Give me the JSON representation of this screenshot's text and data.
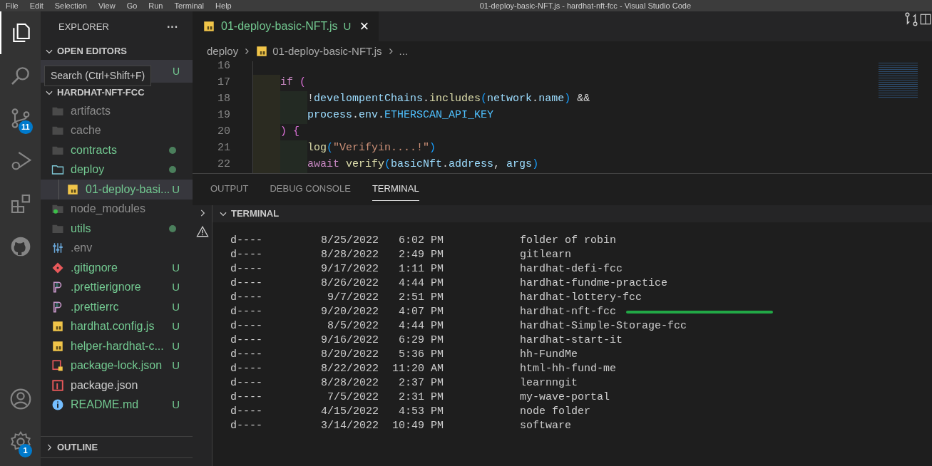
{
  "menu_bar": {
    "items": [
      "File",
      "Edit",
      "Selection",
      "View",
      "Go",
      "Run",
      "Terminal",
      "Help"
    ],
    "title": "01-deploy-basic-NFT.js - hardhat-nft-fcc - Visual Studio Code"
  },
  "activity_bar": [
    {
      "kind": "explorer",
      "selected": true
    },
    {
      "kind": "search",
      "selected": false
    },
    {
      "kind": "source-control",
      "selected": false,
      "badge": "11"
    },
    {
      "kind": "run-debug",
      "selected": false
    },
    {
      "kind": "extensions",
      "selected": false
    },
    {
      "kind": "github",
      "selected": false
    }
  ],
  "activity_bottom": [
    {
      "kind": "account"
    },
    {
      "kind": "settings",
      "badge": "1"
    }
  ],
  "tooltip": "Search (Ctrl+Shift+F)",
  "sidebar": {
    "title": "EXPLORER",
    "more": "···",
    "open_editors": {
      "title": "OPEN EDITORS",
      "expanded": true,
      "items": [
        {
          "decoration": "U"
        }
      ]
    },
    "project": {
      "title": "HARDHAT-NFT-FCC",
      "expanded": true,
      "items": [
        {
          "name": "artifacts",
          "kind": "folder",
          "ignored": true,
          "dot": false,
          "selected": false
        },
        {
          "name": "cache",
          "kind": "folder",
          "ignored": true,
          "dot": false,
          "selected": false
        },
        {
          "name": "contracts",
          "kind": "folder",
          "untracked": true,
          "ignored": false,
          "dot": true,
          "selected": false
        },
        {
          "name": "deploy",
          "kind": "folder-open",
          "untracked": true,
          "ignored": false,
          "dot": true,
          "selected": false,
          "children": [
            {
              "name": "01-deploy-basi...",
              "kind": "js",
              "untracked": true,
              "ignored": false,
              "decoration": "U",
              "selected": true
            }
          ]
        },
        {
          "name": "node_modules",
          "kind": "folder-node",
          "ignored": true,
          "dot": false,
          "selected": false
        },
        {
          "name": "utils",
          "kind": "folder",
          "untracked": true,
          "ignored": false,
          "dot": true,
          "selected": false
        },
        {
          "name": ".env",
          "kind": "env",
          "ignored": true,
          "selected": false
        },
        {
          "name": ".gitignore",
          "kind": "git",
          "untracked": true,
          "ignored": false,
          "decoration": "U",
          "selected": false
        },
        {
          "name": ".prettierignore",
          "kind": "prettier",
          "untracked": true,
          "ignored": false,
          "decoration": "U",
          "selected": false
        },
        {
          "name": ".prettierrc",
          "kind": "prettier",
          "untracked": true,
          "ignored": false,
          "decoration": "U",
          "selected": false
        },
        {
          "name": "hardhat.config.js",
          "kind": "js",
          "untracked": true,
          "ignored": false,
          "decoration": "U",
          "selected": false
        },
        {
          "name": "helper-hardhat-c...",
          "kind": "js",
          "untracked": true,
          "ignored": false,
          "decoration": "U",
          "selected": false
        },
        {
          "name": "package-lock.json",
          "kind": "npm-lock",
          "untracked": true,
          "ignored": false,
          "decoration": "U",
          "selected": false
        },
        {
          "name": "package.json",
          "kind": "npm",
          "untracked": false,
          "ignored": false,
          "selected": false
        },
        {
          "name": "README.md",
          "kind": "info",
          "untracked": true,
          "ignored": false,
          "decoration": "U",
          "selected": false
        }
      ]
    },
    "outline": {
      "title": "OUTLINE",
      "expanded": false
    }
  },
  "editor": {
    "tabs": [
      {
        "label": "01-deploy-basic-NFT.js",
        "decoration": "U",
        "close": "×",
        "selected": true
      }
    ],
    "breadcrumb": [
      "deploy",
      "01-deploy-basic-NFT.js",
      "..."
    ],
    "lines": [
      {
        "number": "16"
      },
      {
        "number": "17",
        "tokens": [
          {
            "text": "if ",
            "kind": "keyword"
          },
          {
            "text": "(",
            "kind": "bracket1"
          }
        ],
        "children": [
          {
            "number": "18",
            "tokens": [
              {
                "text": "!",
                "kind": "plain"
              },
              {
                "text": "develompentChains",
                "kind": "variable"
              },
              {
                "text": ".",
                "kind": "plain"
              },
              {
                "text": "includes",
                "kind": "function"
              },
              {
                "text": "(",
                "kind": "bracket2"
              },
              {
                "text": "network",
                "kind": "variable"
              },
              {
                "text": ".",
                "kind": "plain"
              },
              {
                "text": "name",
                "kind": "variable"
              },
              {
                "text": ")",
                "kind": "bracket2"
              },
              {
                "text": " &&",
                "kind": "plain"
              }
            ]
          },
          {
            "number": "19",
            "tokens": [
              {
                "text": "process",
                "kind": "variable"
              },
              {
                "text": ".",
                "kind": "plain"
              },
              {
                "text": "env",
                "kind": "variable"
              },
              {
                "text": ".",
                "kind": "plain"
              },
              {
                "text": "ETHERSCAN_API_KEY",
                "kind": "constant"
              }
            ]
          }
        ]
      },
      {
        "number": "20",
        "tokens": [
          {
            "text": ")",
            "kind": "bracket1"
          },
          {
            "text": " {",
            "kind": "bracket1"
          }
        ],
        "children": [
          {
            "number": "21",
            "tokens": [
              {
                "text": "log",
                "kind": "function"
              },
              {
                "text": "(",
                "kind": "bracket2"
              },
              {
                "text": "\"Verifyin....!\"",
                "kind": "string"
              },
              {
                "text": ")",
                "kind": "bracket2"
              }
            ]
          },
          {
            "number": "22",
            "tokens": [
              {
                "text": "await ",
                "kind": "keyword"
              },
              {
                "text": "verify",
                "kind": "function"
              },
              {
                "text": "(",
                "kind": "bracket2"
              },
              {
                "text": "basicNft",
                "kind": "variable"
              },
              {
                "text": ".",
                "kind": "plain"
              },
              {
                "text": "address",
                "kind": "variable"
              },
              {
                "text": ", ",
                "kind": "plain"
              },
              {
                "text": "args",
                "kind": "variable"
              },
              {
                "text": ")",
                "kind": "bracket2"
              }
            ]
          }
        ]
      }
    ]
  },
  "panel": {
    "tabs": [
      {
        "label": "OUTPUT",
        "selected": false
      },
      {
        "label": "DEBUG CONSOLE",
        "selected": false
      },
      {
        "label": "TERMINAL",
        "selected": true
      }
    ],
    "terminal_title": "TERMINAL",
    "rows": [
      {
        "mode": "d----",
        "date": "8/25/2022",
        "time": "6:02 PM",
        "name": "folder of robin",
        "marked": false
      },
      {
        "mode": "d----",
        "date": "8/28/2022",
        "time": "2:49 PM",
        "name": "gitlearn",
        "marked": false
      },
      {
        "mode": "d----",
        "date": "9/17/2022",
        "time": "1:11 PM",
        "name": "hardhat-defi-fcc",
        "marked": false
      },
      {
        "mode": "d----",
        "date": "8/26/2022",
        "time": "4:44 PM",
        "name": "hardhat-fundme-practice",
        "marked": false
      },
      {
        "mode": "d----",
        "date": "9/7/2022",
        "time": "2:51 PM",
        "name": "hardhat-lottery-fcc",
        "marked": false
      },
      {
        "mode": "d----",
        "date": "9/20/2022",
        "time": "4:07 PM",
        "name": "hardhat-nft-fcc",
        "marked": true
      },
      {
        "mode": "d----",
        "date": "8/5/2022",
        "time": "4:44 PM",
        "name": "hardhat-Simple-Storage-fcc",
        "marked": false
      },
      {
        "mode": "d----",
        "date": "9/16/2022",
        "time": "6:29 PM",
        "name": "hardhat-start-it",
        "marked": false
      },
      {
        "mode": "d----",
        "date": "8/20/2022",
        "time": "5:36 PM",
        "name": "hh-FundMe",
        "marked": false
      },
      {
        "mode": "d----",
        "date": "8/22/2022",
        "time": "11:20 AM",
        "name": "html-hh-fund-me",
        "marked": false
      },
      {
        "mode": "d----",
        "date": "8/28/2022",
        "time": "2:37 PM",
        "name": "learnngit",
        "marked": false
      },
      {
        "mode": "d----",
        "date": "7/5/2022",
        "time": "2:31 PM",
        "name": "my-wave-portal",
        "marked": false
      },
      {
        "mode": "d----",
        "date": "4/15/2022",
        "time": "4:53 PM",
        "name": "node folder",
        "marked": false
      },
      {
        "mode": "d----",
        "date": "3/14/2022",
        "time": "10:49 PM",
        "name": "software",
        "marked": false
      }
    ]
  }
}
